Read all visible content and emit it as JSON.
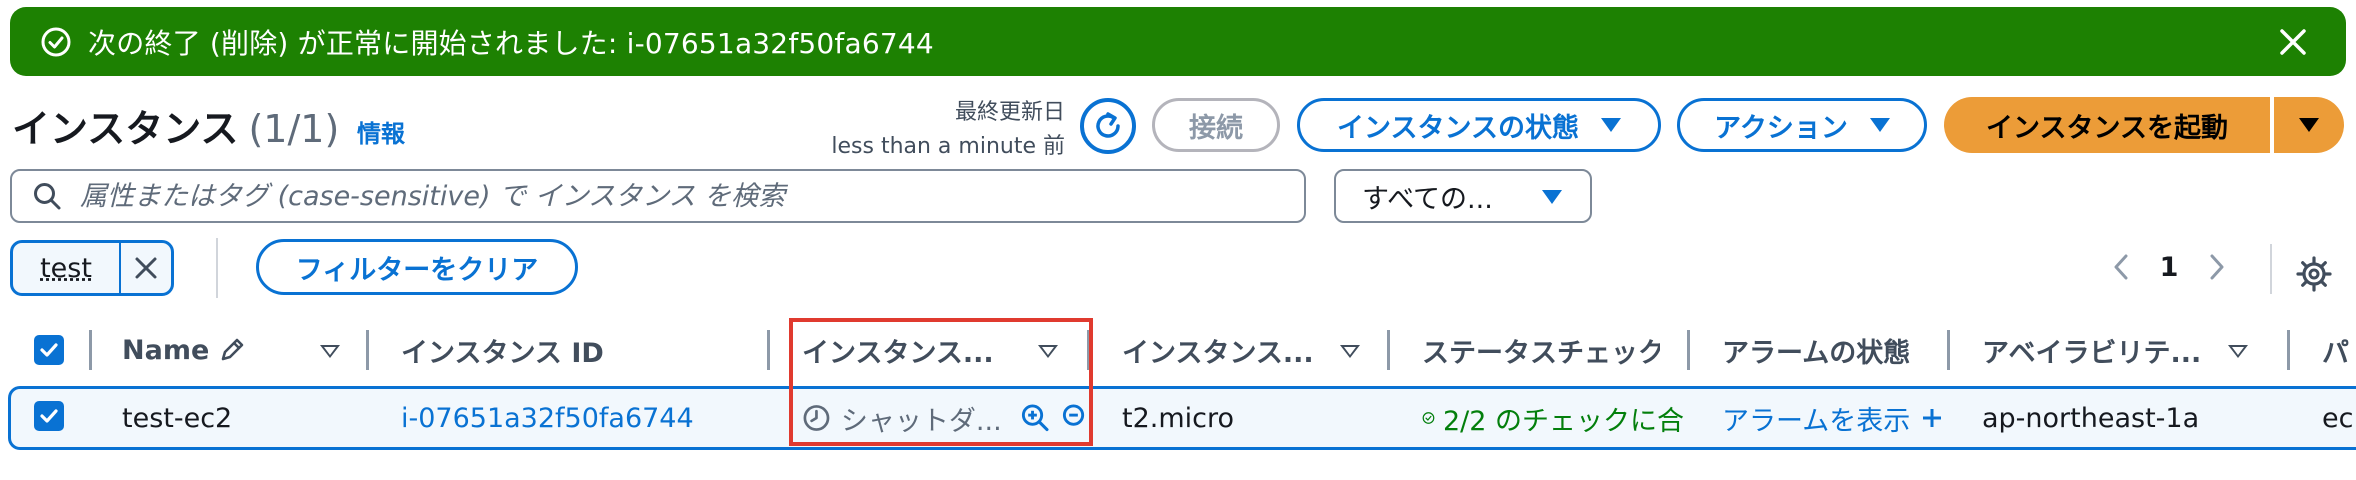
{
  "flash": {
    "message": "次の終了 (削除) が正常に開始されました: i-07651a32f50fa6744",
    "icons": {
      "status": "check-circle-icon",
      "dismiss": "close-icon"
    }
  },
  "header": {
    "title": "インスタンス",
    "count": "(1/1)",
    "info": "情報",
    "last_updated_label": "最終更新日",
    "last_updated_value": "less than a minute 前",
    "connect": "接続",
    "instance_state": "インスタンスの状態",
    "actions": "アクション",
    "launch": "インスタンスを起動"
  },
  "search": {
    "placeholder": "属性またはタグ (case-sensitive) で インスタンス を検索",
    "filter_select": "すべての..."
  },
  "filters": {
    "token": "test",
    "clear": "フィルターをクリア"
  },
  "pagination": {
    "current_page": "1"
  },
  "table": {
    "columns": [
      "Name",
      "インスタンス ID",
      "インスタンス...",
      "インスタンス...",
      "ステータスチェック",
      "アラームの状態",
      "アベイラビリテ...",
      "パ"
    ],
    "rows": [
      {
        "name": "test-ec2",
        "instance_id": "i-07651a32f50fa6744",
        "state": "シャットダ...",
        "type": "t2.micro",
        "status_check": "2/2 のチェックに合",
        "alarm": "アラームを表示",
        "az": "ap-northeast-1a",
        "public": "ec"
      }
    ]
  },
  "colors": {
    "success": "#1d8102",
    "link": "#0972d3",
    "primary": "#ec9c38",
    "highlight": "#e03a2f"
  }
}
